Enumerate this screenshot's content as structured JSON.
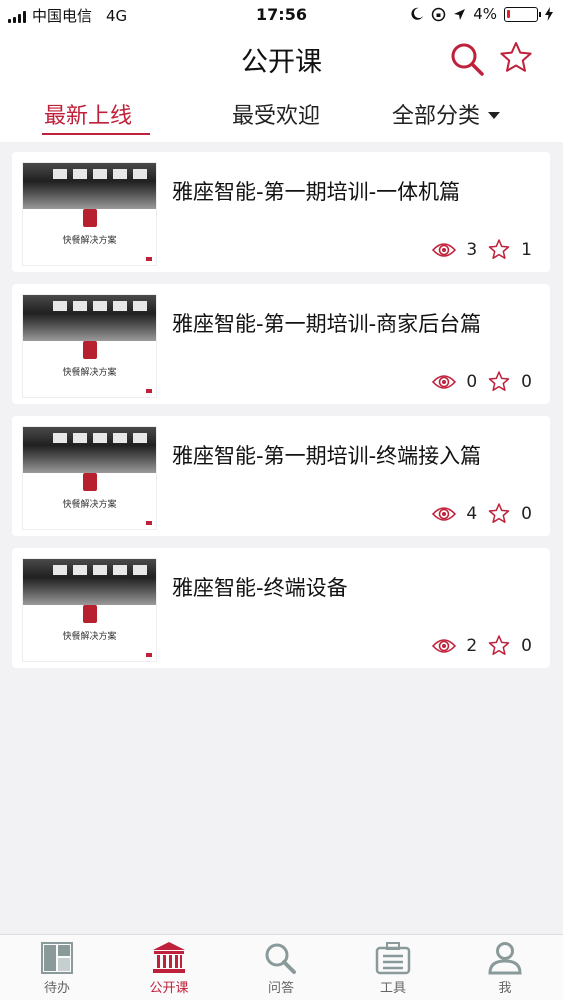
{
  "status_bar": {
    "carrier": "中国电信",
    "network": "4G",
    "time": "17:56",
    "battery": "4%"
  },
  "nav": {
    "title": "公开课",
    "search_icon": "search-icon",
    "favorite_icon": "star-icon"
  },
  "tabs": [
    {
      "label": "最新上线",
      "active": true
    },
    {
      "label": "最受欢迎",
      "active": false
    },
    {
      "label": "全部分类",
      "active": false
    }
  ],
  "courses": [
    {
      "title": "雅座智能-第一期培训-一体机篇",
      "views": "3",
      "favorites": "1",
      "thumb_caption": "快餐解决方案"
    },
    {
      "title": "雅座智能-第一期培训-商家后台篇",
      "views": "0",
      "favorites": "0",
      "thumb_caption": "快餐解决方案"
    },
    {
      "title": "雅座智能-第一期培训-终端接入篇",
      "views": "4",
      "favorites": "0",
      "thumb_caption": "快餐解决方案"
    },
    {
      "title": "雅座智能-终端设备",
      "views": "2",
      "favorites": "0",
      "thumb_caption": "快餐解决方案"
    }
  ],
  "bottom_tabs": [
    {
      "label": "待办",
      "icon": "layout-icon",
      "active": false
    },
    {
      "label": "公开课",
      "icon": "bank-icon",
      "active": true
    },
    {
      "label": "问答",
      "icon": "search-icon",
      "active": false
    },
    {
      "label": "工具",
      "icon": "toolbox-icon",
      "active": false
    },
    {
      "label": "我",
      "icon": "user-icon",
      "active": false
    }
  ],
  "colors": {
    "accent": "#c0213a",
    "inactive_icon": "#8a9a9a",
    "background": "#f2f2f5"
  }
}
